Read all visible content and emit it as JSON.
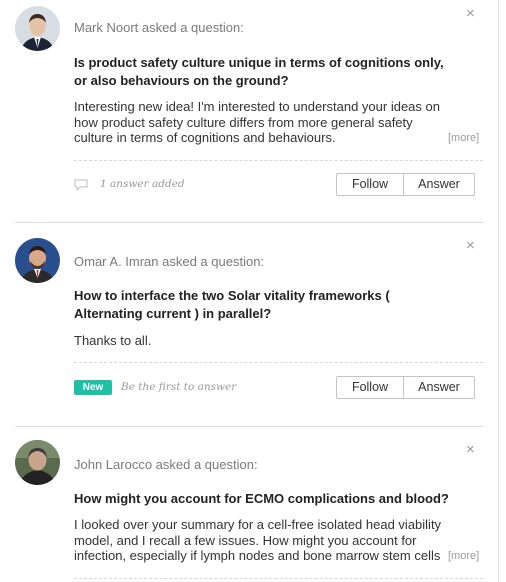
{
  "questions": [
    {
      "asker": "Mark Noort asked a question:",
      "title": "Is product safety culture unique in terms of cognitions only, or also behaviours on the ground?",
      "body": "Interesting new idea! I'm interested to understand your ideas on how product safety culture differs from more general safety culture in terms of cognitions and behaviours.",
      "more": "[more]",
      "meta": "1 answer added",
      "badge": "",
      "follow": "Follow",
      "answer": "Answer",
      "close": "×",
      "avatar_colors": {
        "bg": "#d8dde3",
        "face": "#e6c2a5",
        "hair": "#3b2a22",
        "suit": "#1c2535"
      }
    },
    {
      "asker": "Omar A. Imran asked a question:",
      "title": "How to interface the two Solar vitality frameworks ( Alternating current ) in parallel?",
      "body": "Thanks to all.",
      "more": "",
      "meta": "Be the first to answer",
      "badge": "New",
      "follow": "Follow",
      "answer": "Answer",
      "close": "×",
      "avatar_colors": {
        "bg": "#2a4f8f",
        "face": "#d9a88a",
        "hair": "#2b1c14",
        "suit": "#2a2a2a"
      }
    },
    {
      "asker": "John Larocco asked a question:",
      "title": "How might you account for ECMO complications and blood?",
      "body": "I looked over your summary for a cell-free isolated head viability model, and I recall a few issues. How might you account for infection, especially if lymph nodes and bone marrow stem cells",
      "more": "[more]",
      "close": "×",
      "avatar_colors": {
        "bg": "#5a6a4e",
        "face": "#c9a48c",
        "hair": "#3a3a3a",
        "suit": "#222222"
      }
    }
  ],
  "colors": {
    "accent_badge": "#1ec0a6",
    "text_muted": "#7a7a7a"
  }
}
